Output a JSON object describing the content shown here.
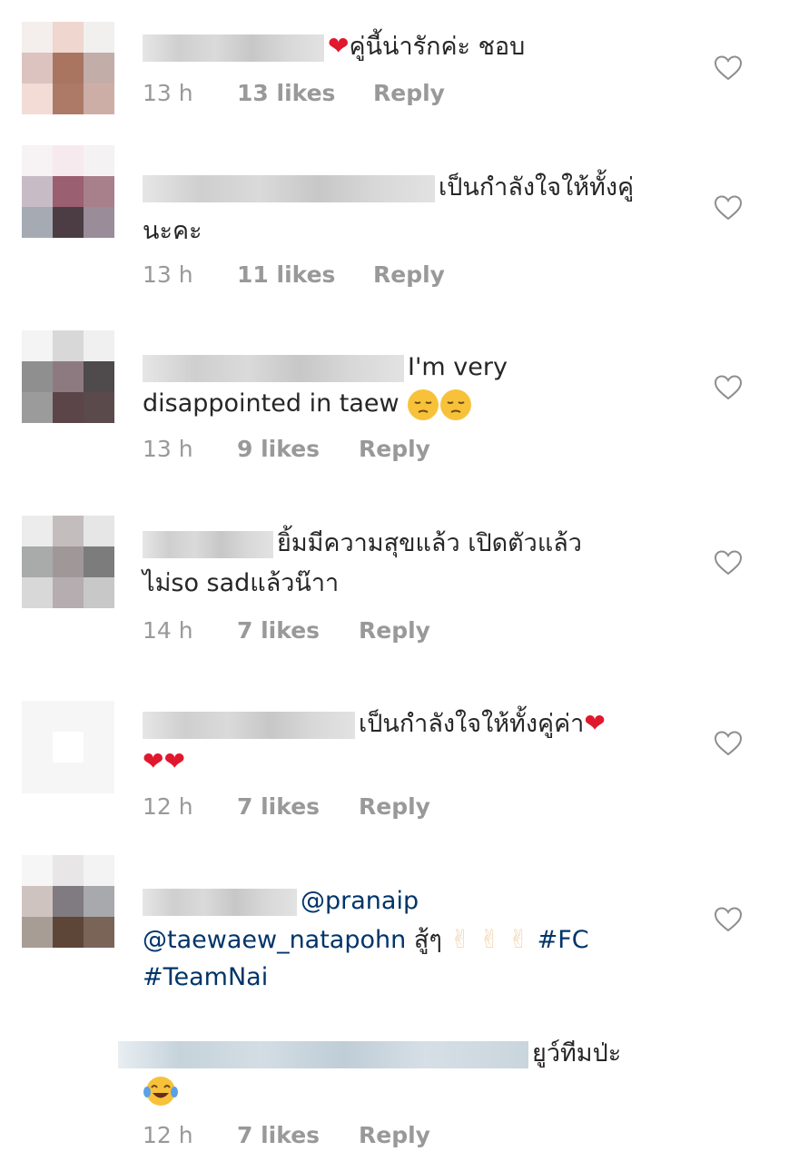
{
  "comments": [
    {
      "text": "คู่นี้น่ารักค่ะ ชอบ",
      "time": "13 h",
      "likes": "13 likes",
      "reply": "Reply"
    },
    {
      "text": "เป็นกำลังใจให้ทั้งคู่",
      "text2": "นะคะ",
      "time": "13 h",
      "likes": "11 likes",
      "reply": "Reply"
    },
    {
      "text": "I'm very",
      "text2": "disappointed in taew",
      "time": "13 h",
      "likes": "9 likes",
      "reply": "Reply"
    },
    {
      "text": "ยิ้มมีความสุขแล้ว เปิดตัวแล้ว",
      "text2": "ไม่so sadแล้วน๊าา",
      "time": "14 h",
      "likes": "7 likes",
      "reply": "Reply"
    },
    {
      "text": "เป็นกำลังใจให้ทั้งคู่ค่า",
      "time": "12 h",
      "likes": "7 likes",
      "reply": "Reply"
    },
    {
      "mention1": "@pranaip",
      "mention2": "@taewaew_natapohn",
      "text": "สู้ๆ",
      "hashtag1": "#FC",
      "hashtag2": "#TeamNai"
    },
    {
      "text": "ยูว์ทีมป่ะ",
      "time": "12 h",
      "likes": "7 likes",
      "reply": "Reply"
    }
  ],
  "icons": {
    "like": "heart-outline-icon",
    "heart_emoji": "red-heart-emoji",
    "pensive_emoji": "pensive-face-emoji",
    "peace_emoji": "victory-hand-emoji",
    "laugh_emoji": "tears-of-joy-emoji"
  },
  "colors": {
    "meta": "#999999",
    "mention": "#003569",
    "heart": "#e0182d"
  }
}
